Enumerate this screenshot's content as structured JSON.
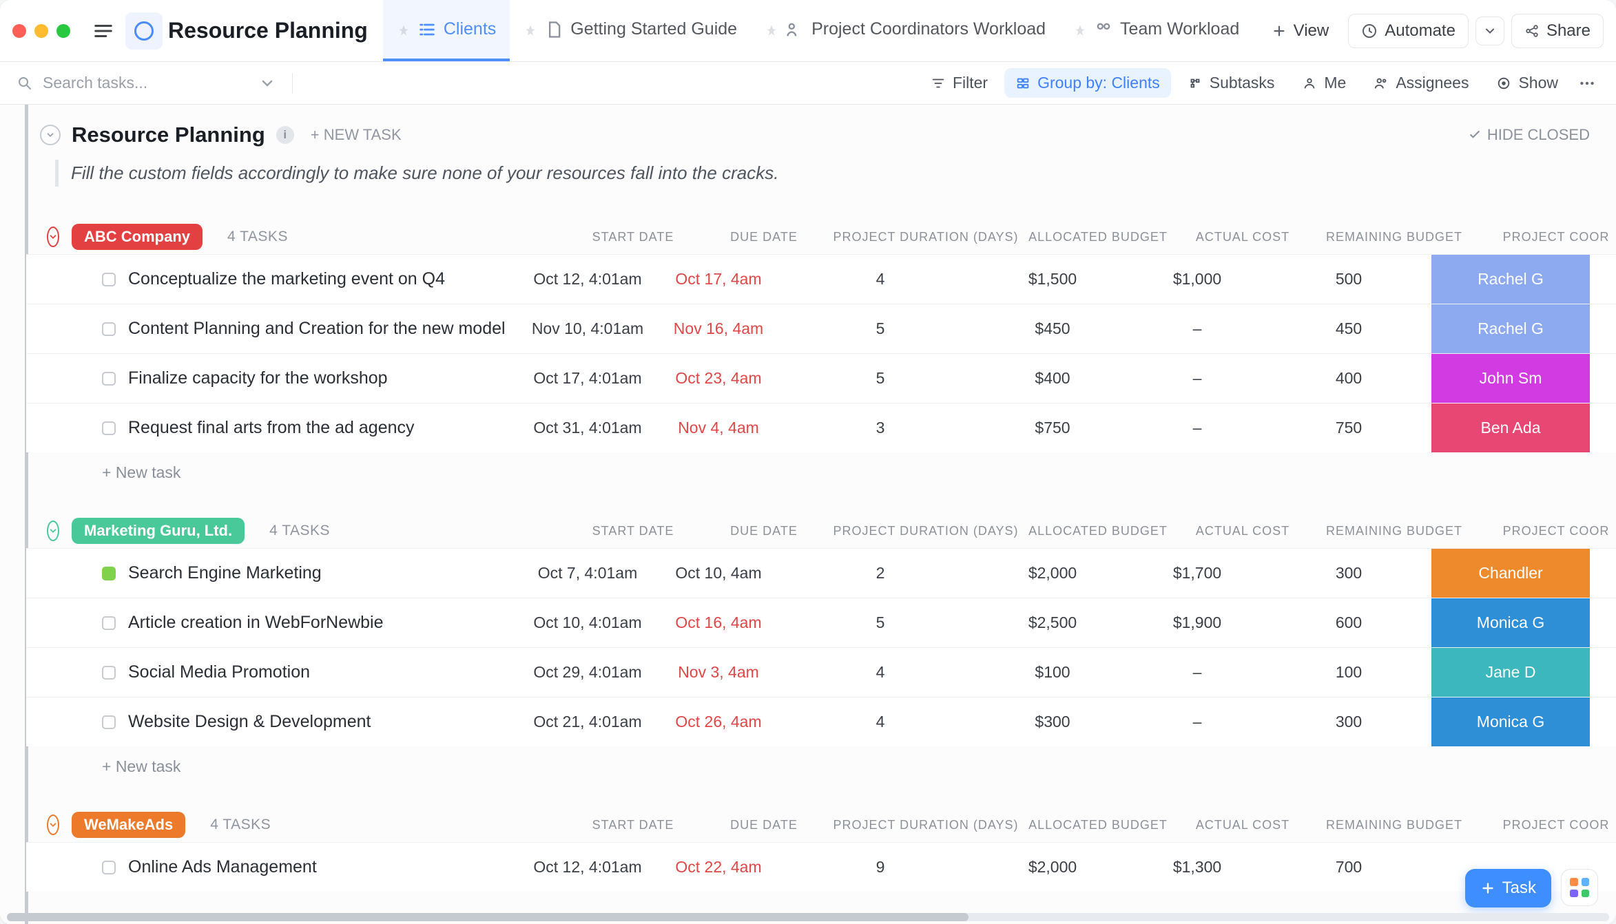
{
  "header": {
    "title": "Resource Planning",
    "tabs": [
      {
        "label": "Clients",
        "icon": "list",
        "active": true
      },
      {
        "label": "Getting Started Guide",
        "icon": "doc"
      },
      {
        "label": "Project Coordinators Workload",
        "icon": "workload"
      },
      {
        "label": "Team Workload",
        "icon": "workload"
      }
    ],
    "view_button": "View",
    "automate": "Automate",
    "share": "Share"
  },
  "toolbar": {
    "search_placeholder": "Search tasks...",
    "filter": "Filter",
    "group_by": "Group by: Clients",
    "subtasks": "Subtasks",
    "me": "Me",
    "assignees": "Assignees",
    "show": "Show"
  },
  "list": {
    "title": "Resource Planning",
    "new_task_label": "+ NEW TASK",
    "hide_closed": "HIDE CLOSED",
    "description": "Fill the custom fields accordingly to make sure none of your resources fall into the cracks.",
    "new_task_inline": "+ New task"
  },
  "columns": [
    "START DATE",
    "DUE DATE",
    "PROJECT DURATION (DAYS)",
    "ALLOCATED BUDGET",
    "ACTUAL COST",
    "REMAINING BUDGET",
    "PROJECT COOR"
  ],
  "groups": [
    {
      "name": "ABC Company",
      "count": "4 TASKS",
      "color": "#e34141",
      "tasks": [
        {
          "title": "Conceptualize the marketing event on Q4",
          "start": "Oct 12, 4:01am",
          "due": "Oct 17, 4am",
          "due_overdue": true,
          "duration": "4",
          "budget": "$1,500",
          "cost": "$1,000",
          "remaining": "500",
          "coord": "Rachel G",
          "coord_color": "#8da9f0",
          "status": "open"
        },
        {
          "title": "Content Planning and Creation for the new model",
          "start": "Nov 10, 4:01am",
          "due": "Nov 16, 4am",
          "due_overdue": true,
          "duration": "5",
          "budget": "$450",
          "cost": "–",
          "remaining": "450",
          "coord": "Rachel G",
          "coord_color": "#8da9f0",
          "status": "open"
        },
        {
          "title": "Finalize capacity for the workshop",
          "start": "Oct 17, 4:01am",
          "due": "Oct 23, 4am",
          "due_overdue": true,
          "duration": "5",
          "budget": "$400",
          "cost": "–",
          "remaining": "400",
          "coord": "John Sm",
          "coord_color": "#d23be2",
          "status": "open"
        },
        {
          "title": "Request final arts from the ad agency",
          "start": "Oct 31, 4:01am",
          "due": "Nov 4, 4am",
          "due_overdue": true,
          "duration": "3",
          "budget": "$750",
          "cost": "–",
          "remaining": "750",
          "coord": "Ben Ada",
          "coord_color": "#e94773",
          "status": "open"
        }
      ]
    },
    {
      "name": "Marketing Guru, Ltd.",
      "count": "4 TASKS",
      "color": "#49c99a",
      "tasks": [
        {
          "title": "Search Engine Marketing",
          "start": "Oct 7, 4:01am",
          "due": "Oct 10, 4am",
          "due_overdue": false,
          "duration": "2",
          "budget": "$2,000",
          "cost": "$1,700",
          "remaining": "300",
          "coord": "Chandler",
          "coord_color": "#ee8a2b",
          "status": "done"
        },
        {
          "title": "Article creation in WebForNewbie",
          "start": "Oct 10, 4:01am",
          "due": "Oct 16, 4am",
          "due_overdue": true,
          "duration": "5",
          "budget": "$2,500",
          "cost": "$1,900",
          "remaining": "600",
          "coord": "Monica G",
          "coord_color": "#2f8fd6",
          "status": "open"
        },
        {
          "title": "Social Media Promotion",
          "start": "Oct 29, 4:01am",
          "due": "Nov 3, 4am",
          "due_overdue": true,
          "duration": "4",
          "budget": "$100",
          "cost": "–",
          "remaining": "100",
          "coord": "Jane D",
          "coord_color": "#3bb7bd",
          "status": "open"
        },
        {
          "title": "Website Design & Development",
          "start": "Oct 21, 4:01am",
          "due": "Oct 26, 4am",
          "due_overdue": true,
          "duration": "4",
          "budget": "$300",
          "cost": "–",
          "remaining": "300",
          "coord": "Monica G",
          "coord_color": "#2f8fd6",
          "status": "open"
        }
      ]
    },
    {
      "name": "WeMakeAds",
      "count": "4 TASKS",
      "color": "#ed7a2a",
      "tasks": [
        {
          "title": "Online Ads Management",
          "start": "Oct 12, 4:01am",
          "due": "Oct 22, 4am",
          "due_overdue": true,
          "duration": "9",
          "budget": "$2,000",
          "cost": "$1,300",
          "remaining": "700",
          "coord": "",
          "coord_color": "#fff",
          "status": "open"
        }
      ]
    }
  ],
  "fab": {
    "task": "Task"
  }
}
